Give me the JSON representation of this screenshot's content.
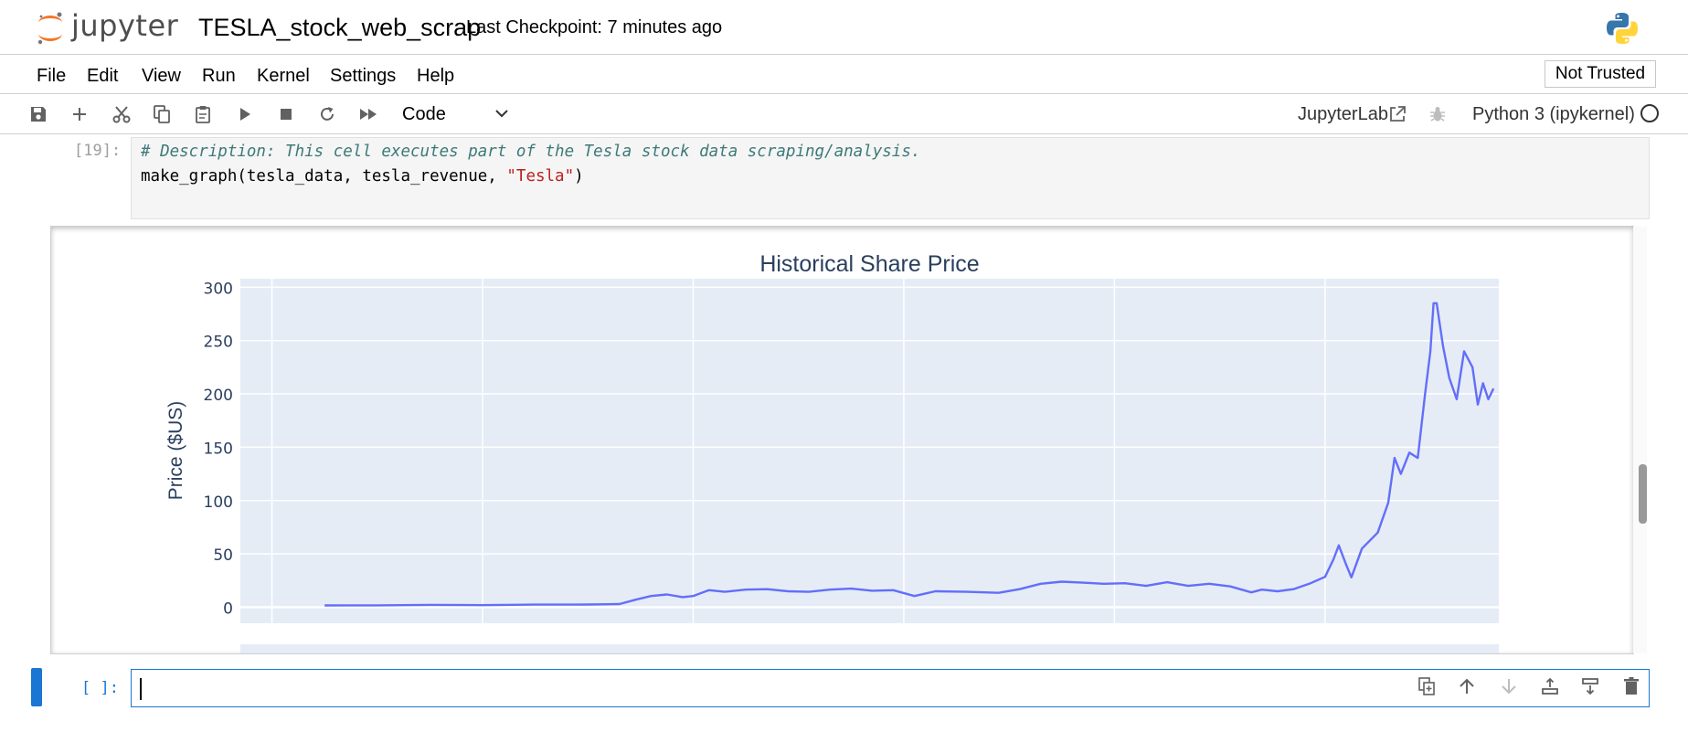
{
  "header": {
    "logo_text": "jupyter",
    "notebook_title": "TESLA_stock_web_scrap",
    "checkpoint": "Last Checkpoint: 7 minutes ago"
  },
  "menu": {
    "items": [
      "File",
      "Edit",
      "View",
      "Run",
      "Kernel",
      "Settings",
      "Help"
    ],
    "trusted": "Not Trusted"
  },
  "toolbar": {
    "cell_type": "Code",
    "jupyterlab": "JupyterLab",
    "kernel": "Python 3 (ipykernel)"
  },
  "cells": {
    "code_prompt": "[19]:",
    "code_comment": "# Description: This cell executes part of the Tesla stock data scraping/analysis.",
    "code_call": "make_graph(tesla_data, tesla_revenue, ",
    "code_string": "\"Tesla\"",
    "code_close": ")",
    "empty_prompt": "[ ]:"
  },
  "colors": {
    "line": "#636efa",
    "plot_bg": "#e5ecf6",
    "accent": "#1976d2",
    "title": "#2a3f5f"
  },
  "chart_data": {
    "type": "line",
    "title": "Historical Share Price",
    "ylabel": "Price ($US)",
    "ylim": [
      -15,
      308
    ],
    "yticks": [
      0,
      50,
      100,
      150,
      200,
      250,
      300
    ],
    "xlim": [
      2009.7,
      2021.65
    ],
    "x_gridlines": [
      2010,
      2012,
      2014,
      2016,
      2018,
      2020
    ],
    "grid": true,
    "series": [
      {
        "x": [
          2010.5,
          2011.0,
          2011.5,
          2012.0,
          2012.5,
          2013.0,
          2013.2,
          2013.3,
          2013.45,
          2013.6,
          2013.75,
          2013.9,
          2014.0,
          2014.15,
          2014.3,
          2014.5,
          2014.7,
          2014.9,
          2015.1,
          2015.3,
          2015.5,
          2015.7,
          2015.9,
          2016.1,
          2016.3,
          2016.6,
          2016.9,
          2017.1,
          2017.3,
          2017.5,
          2017.7,
          2017.9,
          2018.1,
          2018.3,
          2018.5,
          2018.7,
          2018.9,
          2019.1,
          2019.3,
          2019.4,
          2019.55,
          2019.7,
          2019.85,
          2020.0,
          2020.08,
          2020.13,
          2020.2,
          2020.25,
          2020.35,
          2020.5,
          2020.6,
          2020.66,
          2020.72,
          2020.8,
          2020.88,
          2020.95,
          2021.0,
          2021.03,
          2021.06,
          2021.12,
          2021.18,
          2021.25,
          2021.32,
          2021.4,
          2021.45,
          2021.5,
          2021.55,
          2021.6
        ],
        "y": [
          1.7,
          1.8,
          2.2,
          2.0,
          2.5,
          2.6,
          2.8,
          3.0,
          7.0,
          10.5,
          12.0,
          9.5,
          10.5,
          16.0,
          14.5,
          16.5,
          17.0,
          15.0,
          14.5,
          16.5,
          17.5,
          15.5,
          16.0,
          10.5,
          15.0,
          14.5,
          13.5,
          17.0,
          22.0,
          24.0,
          23.0,
          22.0,
          22.5,
          20.0,
          23.5,
          20.0,
          22.0,
          19.5,
          14.0,
          16.5,
          15.0,
          17.0,
          22.0,
          28.5,
          45.0,
          58.0,
          40.0,
          28.0,
          55.0,
          70.0,
          98.0,
          140.0,
          125.0,
          145.0,
          140.0,
          200.0,
          240.0,
          285.0,
          285.0,
          245.0,
          215.0,
          195.0,
          240.0,
          225.0,
          190.0,
          210.0,
          195.0,
          205.0
        ]
      }
    ]
  }
}
